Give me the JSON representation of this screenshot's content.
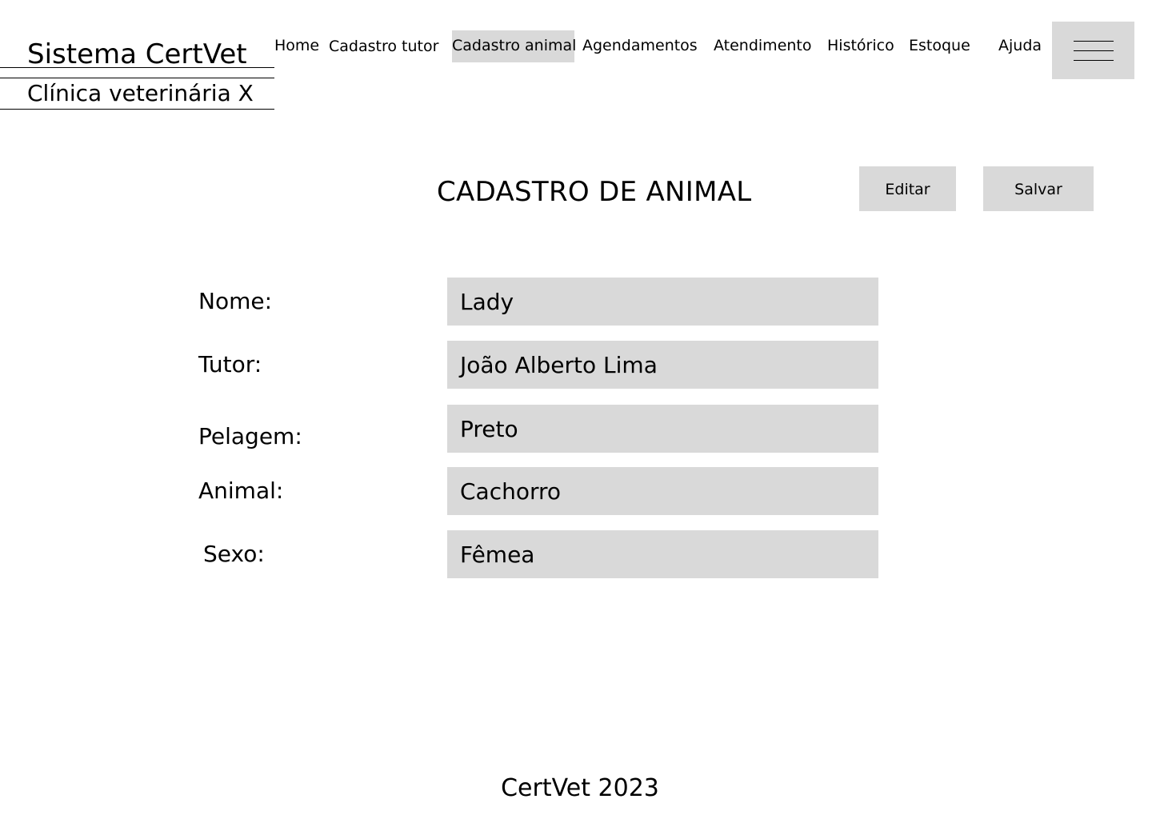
{
  "brand": {
    "title": "Sistema CertVet",
    "subtitle": "Clínica veterinária X"
  },
  "nav": {
    "items": [
      {
        "label": "Home",
        "active": false
      },
      {
        "label": "Cadastro tutor",
        "active": false
      },
      {
        "label": "Cadastro animal",
        "active": true
      },
      {
        "label": "Agendamentos",
        "active": false
      },
      {
        "label": "Atendimento",
        "active": false
      },
      {
        "label": "Histórico",
        "active": false
      },
      {
        "label": "Estoque",
        "active": false
      },
      {
        "label": "Ajuda",
        "active": false
      }
    ],
    "menu_icon": "hamburger-menu-icon"
  },
  "page": {
    "title": "CADASTRO DE ANIMAL",
    "edit_label": "Editar",
    "save_label": "Salvar"
  },
  "form": {
    "fields": [
      {
        "label": "Nome:",
        "value": "Lady"
      },
      {
        "label": "Tutor:",
        "value": "João Alberto Lima"
      },
      {
        "label": "Pelagem:",
        "value": "Preto"
      },
      {
        "label": "Animal:",
        "value": "Cachorro"
      },
      {
        "label": "Sexo:",
        "value": "Fêmea"
      }
    ]
  },
  "footer": {
    "text": "CertVet 2023"
  },
  "colors": {
    "control_background": "#d9d9d9",
    "text": "#000000",
    "page_background": "#ffffff"
  }
}
